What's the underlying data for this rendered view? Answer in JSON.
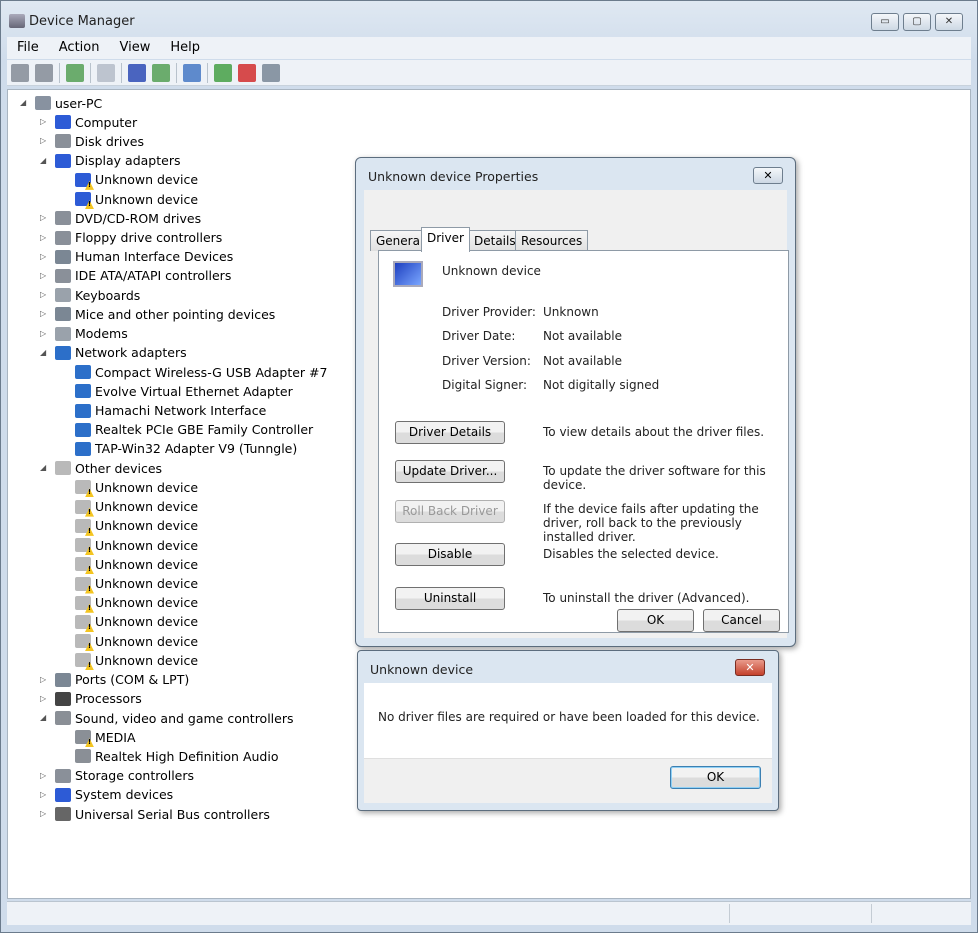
{
  "window": {
    "title": "Device Manager",
    "min": "▭",
    "max": "▢",
    "close": "✕"
  },
  "menu": [
    "File",
    "Action",
    "View",
    "Help"
  ],
  "toolbar": [
    "back-icon",
    "forward-icon",
    "show-hide-tree-icon",
    "properties-icon",
    "help-icon",
    "action-pane-icon",
    "scan-hardware-icon",
    "update-driver-icon",
    "uninstall-icon",
    "disable-icon"
  ],
  "tree": [
    {
      "label": "user-PC",
      "level": 0,
      "exp": "◢",
      "icon": "computer"
    },
    {
      "label": "Computer",
      "level": 1,
      "exp": "▷",
      "icon": "monitor"
    },
    {
      "label": "Disk drives",
      "level": 1,
      "exp": "▷",
      "icon": "disk"
    },
    {
      "label": "Display adapters",
      "level": 1,
      "exp": "◢",
      "icon": "monitor"
    },
    {
      "label": "Unknown device",
      "level": 2,
      "icon": "monitor",
      "warn": true
    },
    {
      "label": "Unknown device",
      "level": 2,
      "icon": "monitor",
      "warn": true
    },
    {
      "label": "DVD/CD-ROM drives",
      "level": 1,
      "exp": "▷",
      "icon": "disk"
    },
    {
      "label": "Floppy drive controllers",
      "level": 1,
      "exp": "▷",
      "icon": "disk"
    },
    {
      "label": "Human Interface Devices",
      "level": 1,
      "exp": "▷",
      "icon": "hid"
    },
    {
      "label": "IDE ATA/ATAPI controllers",
      "level": 1,
      "exp": "▷",
      "icon": "disk"
    },
    {
      "label": "Keyboards",
      "level": 1,
      "exp": "▷",
      "icon": "kbd"
    },
    {
      "label": "Mice and other pointing devices",
      "level": 1,
      "exp": "▷",
      "icon": "hid"
    },
    {
      "label": "Modems",
      "level": 1,
      "exp": "▷",
      "icon": "kbd"
    },
    {
      "label": "Network adapters",
      "level": 1,
      "exp": "◢",
      "icon": "net"
    },
    {
      "label": "Compact Wireless-G USB Adapter #7",
      "level": 2,
      "icon": "net"
    },
    {
      "label": "Evolve Virtual Ethernet Adapter",
      "level": 2,
      "icon": "net"
    },
    {
      "label": "Hamachi Network Interface",
      "level": 2,
      "icon": "net"
    },
    {
      "label": "Realtek PCIe GBE Family Controller",
      "level": 2,
      "icon": "net"
    },
    {
      "label": "TAP-Win32 Adapter V9 (Tunngle)",
      "level": 2,
      "icon": "net"
    },
    {
      "label": "Other devices",
      "level": 1,
      "exp": "◢",
      "icon": "unknown"
    },
    {
      "label": "Unknown device",
      "level": 2,
      "icon": "unknown",
      "warn": true
    },
    {
      "label": "Unknown device",
      "level": 2,
      "icon": "unknown",
      "warn": true
    },
    {
      "label": "Unknown device",
      "level": 2,
      "icon": "unknown",
      "warn": true
    },
    {
      "label": "Unknown device",
      "level": 2,
      "icon": "unknown",
      "warn": true
    },
    {
      "label": "Unknown device",
      "level": 2,
      "icon": "unknown",
      "warn": true
    },
    {
      "label": "Unknown device",
      "level": 2,
      "icon": "unknown",
      "warn": true
    },
    {
      "label": "Unknown device",
      "level": 2,
      "icon": "unknown",
      "warn": true
    },
    {
      "label": "Unknown device",
      "level": 2,
      "icon": "unknown",
      "warn": true
    },
    {
      "label": "Unknown device",
      "level": 2,
      "icon": "unknown",
      "warn": true
    },
    {
      "label": "Unknown device",
      "level": 2,
      "icon": "unknown",
      "warn": true
    },
    {
      "label": "Ports (COM & LPT)",
      "level": 1,
      "exp": "▷",
      "icon": "hid"
    },
    {
      "label": "Processors",
      "level": 1,
      "exp": "▷",
      "icon": "cpu"
    },
    {
      "label": "Sound, video and game controllers",
      "level": 1,
      "exp": "◢",
      "icon": "sound"
    },
    {
      "label": "MEDIA",
      "level": 2,
      "icon": "sound",
      "warn": true
    },
    {
      "label": "Realtek High Definition Audio",
      "level": 2,
      "icon": "sound"
    },
    {
      "label": "Storage controllers",
      "level": 1,
      "exp": "▷",
      "icon": "disk"
    },
    {
      "label": "System devices",
      "level": 1,
      "exp": "▷",
      "icon": "monitor"
    },
    {
      "label": "Universal Serial Bus controllers",
      "level": 1,
      "exp": "▷",
      "icon": "usb"
    }
  ],
  "props": {
    "title": "Unknown device Properties",
    "close": "✕",
    "tabs": [
      "General",
      "Driver",
      "Details",
      "Resources"
    ],
    "device_name": "Unknown device",
    "fields": [
      {
        "k": "Driver Provider:",
        "v": "Unknown"
      },
      {
        "k": "Driver Date:",
        "v": "Not available"
      },
      {
        "k": "Driver Version:",
        "v": "Not available"
      },
      {
        "k": "Digital Signer:",
        "v": "Not digitally signed"
      }
    ],
    "actions": [
      {
        "label": "Driver Details",
        "desc": "To view details about the driver files.",
        "disabled": false
      },
      {
        "label": "Update Driver...",
        "desc": "To update the driver software for this device.",
        "disabled": false
      },
      {
        "label": "Roll Back Driver",
        "desc": "If the device fails after updating the driver, roll back to the previously installed driver.",
        "disabled": true
      },
      {
        "label": "Disable",
        "desc": "Disables the selected device.",
        "disabled": false
      },
      {
        "label": "Uninstall",
        "desc": "To uninstall the driver (Advanced).",
        "disabled": false
      }
    ],
    "ok": "OK",
    "cancel": "Cancel"
  },
  "msg": {
    "title": "Unknown device",
    "close": "✕",
    "text": "No driver files are required or have been loaded for this device.",
    "ok": "OK"
  }
}
